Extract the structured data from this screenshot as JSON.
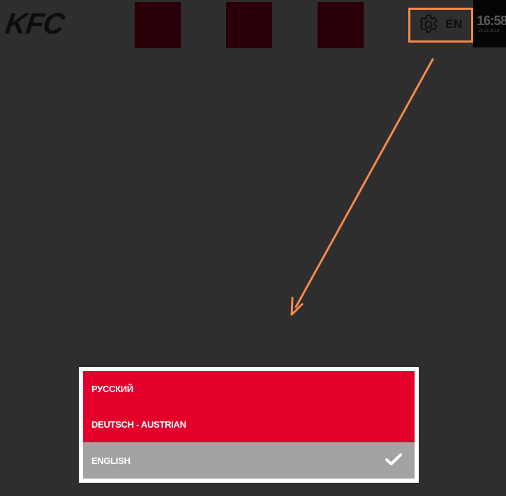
{
  "header": {
    "logo_text": "KFC",
    "settings": {
      "icon": "gear-icon",
      "language_code": "EN"
    },
    "clock": {
      "time": "16:58",
      "date": "19.12.2016"
    }
  },
  "language_menu": {
    "items": [
      {
        "label": "РУССКИЙ",
        "selected": false
      },
      {
        "label": "DEUTSCH - AUSTRIAN",
        "selected": false
      },
      {
        "label": "ENGLISH",
        "selected": true
      }
    ],
    "check_icon": "checkmark-icon"
  },
  "colors": {
    "background": "#2e2e2e",
    "kfc_red": "#e4002b",
    "selected_grey": "#a3a2a4",
    "annotation_orange": "#f58a4b",
    "tile_dark_red": "#2a0008"
  }
}
